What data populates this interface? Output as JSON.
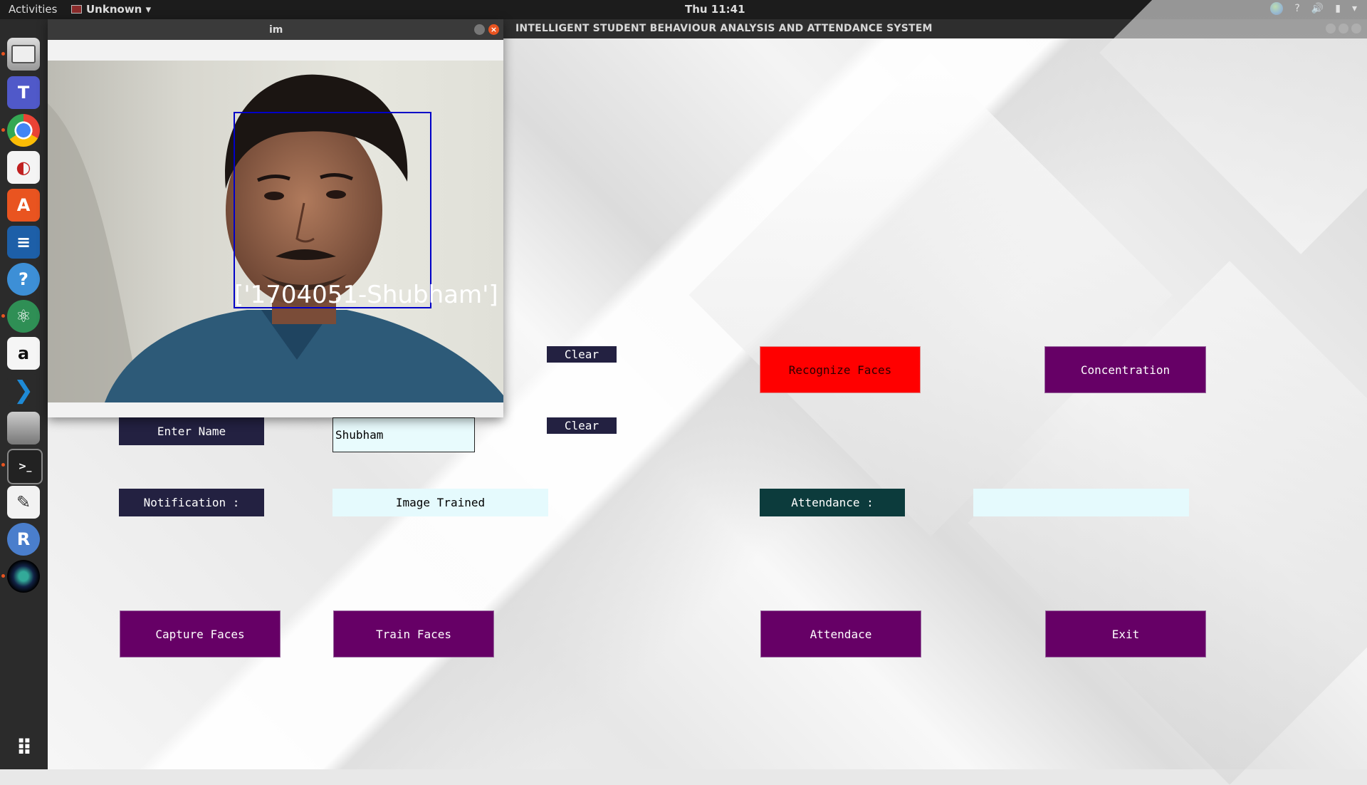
{
  "topbar": {
    "activities": "Activities",
    "app_menu": "Unknown",
    "clock": "Thu 11:41",
    "help": "?"
  },
  "dock": {
    "items": [
      {
        "icon": "file-cabinet-icon"
      },
      {
        "icon": "teams-icon",
        "label": "T"
      },
      {
        "icon": "chrome-icon"
      },
      {
        "icon": "evince-icon"
      },
      {
        "icon": "software-center-icon",
        "label": "A"
      },
      {
        "icon": "writer-icon"
      },
      {
        "icon": "help-icon",
        "label": "?"
      },
      {
        "icon": "atom-icon"
      },
      {
        "icon": "amazon-icon",
        "label": "a"
      },
      {
        "icon": "vscode-icon"
      },
      {
        "icon": "scanner-icon"
      },
      {
        "icon": "terminal-icon",
        "label": ">_"
      },
      {
        "icon": "text-editor-icon"
      },
      {
        "icon": "r-icon",
        "label": "R"
      },
      {
        "icon": "webcam-icon"
      },
      {
        "icon": "app-grid-icon"
      }
    ]
  },
  "main_window": {
    "title": "INTELLIGENT STUDENT BEHAVIOUR ANALYSIS AND ATTENDANCE SYSTEM"
  },
  "camera_window": {
    "title": "im",
    "recognized_label": "['1704051-Shubham']",
    "face_box_color": "#0000c8"
  },
  "form": {
    "clear_1": "Clear",
    "clear_2": "Clear",
    "enter_name_label": "Enter Name",
    "name_value": "Shubham",
    "notification_label": "Notification :",
    "notification_value": "Image Trained",
    "attendance_label": "Attendance :",
    "attendance_value": ""
  },
  "buttons": {
    "recognize": "Recognize Faces",
    "concentration": "Concentration",
    "capture": "Capture Faces",
    "train": "Train Faces",
    "attendance": "Attendace",
    "exit": "Exit"
  },
  "colors": {
    "purple_button": "#660066",
    "navy_label": "#232141",
    "teal_label": "#0c3b3c",
    "recognize_button": "#ff0000",
    "value_field": "#e5fafd"
  }
}
